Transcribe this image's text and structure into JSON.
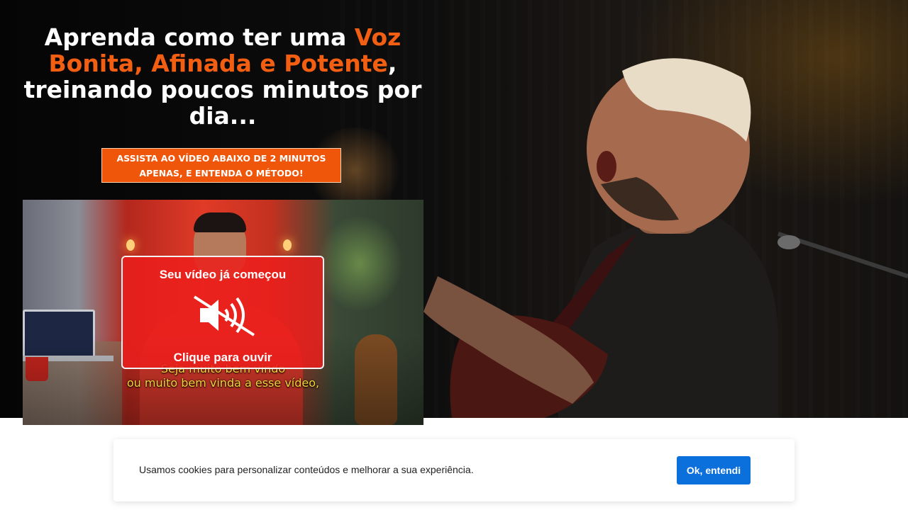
{
  "hero": {
    "headline_part1": "Aprenda como ter uma ",
    "headline_highlight": "Voz Bonita, Afinada e Potente",
    "headline_part2": ", treinando poucos minutos por dia...",
    "highlight_color": "#f25e12",
    "cta_line1": "ASSISTA AO VÍDEO ABAIXO DE 2 MINUTOS",
    "cta_line2": "APENAS, E ENTENDA O MÉTODO!",
    "cta_color": "#f0560a"
  },
  "video": {
    "overlay_title": "Seu vídeo já começou",
    "overlay_icon": "muted-speaker-icon",
    "overlay_cta": "Clique para ouvir",
    "overlay_color": "#ec1e1c",
    "caption_line1": "Seja muito bem vindo",
    "caption_line2": "ou muito bem vinda a esse vídeo,"
  },
  "cookie": {
    "text": "Usamos cookies para personalizar conteúdos e melhorar a sua experiência.",
    "button_label": "Ok, entendi",
    "button_color": "#0b6fdc"
  }
}
